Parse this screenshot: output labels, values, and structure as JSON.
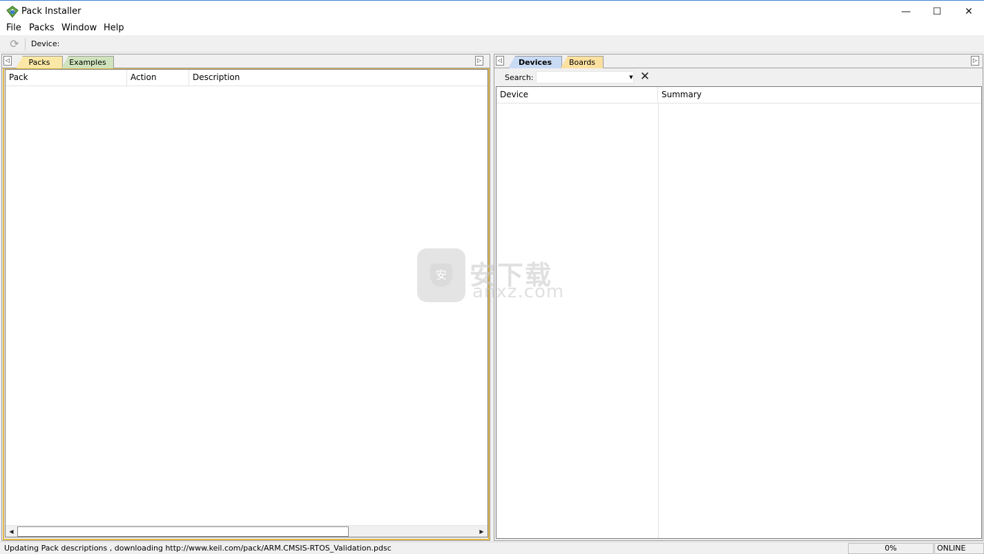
{
  "window": {
    "title": "Pack Installer",
    "minimize_glyph": "—",
    "maximize_glyph": "☐",
    "close_glyph": "✕"
  },
  "menu": [
    "File",
    "Packs",
    "Window",
    "Help"
  ],
  "toolbar": {
    "refresh_icon": "refresh-icon",
    "device_label": "Device:",
    "device_value": ""
  },
  "left_pane": {
    "tabs": [
      {
        "label": "Packs",
        "color": "#fce8a6",
        "active": true
      },
      {
        "label": "Examples",
        "color": "#cfe3bd",
        "active": false
      }
    ],
    "columns": [
      "Pack",
      "Action",
      "Description"
    ],
    "rows": []
  },
  "right_pane": {
    "tabs": [
      {
        "label": "Devices",
        "color": "#c9daf4",
        "active": true
      },
      {
        "label": "Boards",
        "color": "#fce0a0",
        "active": false
      }
    ],
    "search": {
      "label": "Search:",
      "value": "",
      "placeholder": ""
    },
    "columns": [
      "Device",
      "Summary"
    ],
    "rows": []
  },
  "statusbar": {
    "message": "Updating Pack descriptions , downloading http://www.keil.com/pack/ARM.CMSIS-RTOS_Validation.pdsc",
    "progress": "0%",
    "mode": "ONLINE"
  },
  "watermark": {
    "cn": "安下载",
    "en": "anxz.com",
    "badge": "安"
  },
  "colors": {
    "accent_border": "#e0b84a",
    "title_border": "#3c7fd0"
  }
}
